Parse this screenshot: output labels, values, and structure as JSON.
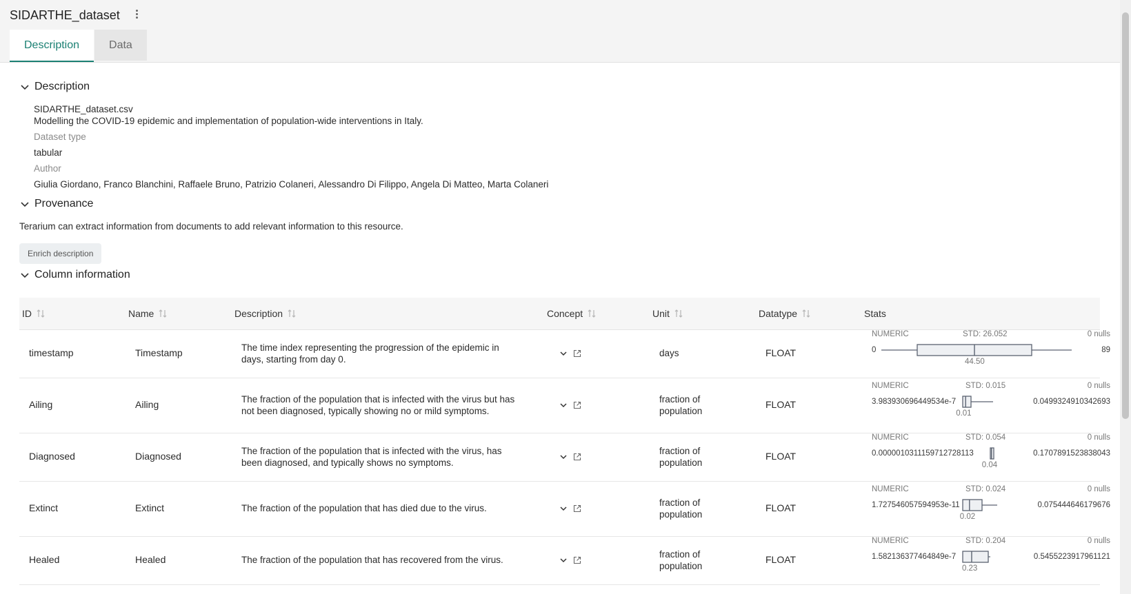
{
  "header": {
    "title": "SIDARTHE_dataset"
  },
  "tabs": [
    {
      "label": "Description"
    },
    {
      "label": "Data"
    }
  ],
  "description": {
    "heading": "Description",
    "filename": "SIDARTHE_dataset.csv",
    "summary": "Modelling the COVID-19 epidemic and implementation of population-wide interventions in Italy.",
    "dataset_type_label": "Dataset type",
    "dataset_type": "tabular",
    "author_label": "Author",
    "author": "Giulia Giordano, Franco Blanchini, Raffaele Bruno, Patrizio Colaneri, Alessandro Di Filippo, Angela Di Matteo, Marta Colaneri"
  },
  "provenance": {
    "heading": "Provenance",
    "text": "Terarium can extract information from documents to add relevant information to this resource.",
    "button": "Enrich description"
  },
  "columns": {
    "heading": "Column information",
    "headers": [
      "ID",
      "Name",
      "Description",
      "Concept",
      "Unit",
      "Datatype",
      "Stats"
    ],
    "rows": [
      {
        "id": "timestamp",
        "name": "Timestamp",
        "desc1": "The time index representing the progression of the epidemic in",
        "desc2": "days, starting from day 0.",
        "unit1": "days",
        "unit2": "",
        "dtype": "FLOAT",
        "s_type": "NUMERIC",
        "s_std": "STD: 26.052",
        "s_nulls": "0 nulls",
        "s_min": "0",
        "s_max": "89",
        "s_median": "44.50",
        "box": {
          "q1": 0.25,
          "med": 0.5,
          "q3": 0.75
        }
      },
      {
        "id": "Ailing",
        "name": "Ailing",
        "desc1": "The fraction of the population that is infected with the virus but has",
        "desc2": "not been diagnosed, typically showing no or mild symptoms.",
        "unit1": "fraction of",
        "unit2": "population",
        "dtype": "FLOAT",
        "s_type": "NUMERIC",
        "s_std": "STD: 0.015",
        "s_nulls": "0 nulls",
        "s_min": "3.983930696449534e-7",
        "s_max": "0.0499324910342693",
        "s_median": "0.01",
        "box": {
          "q1": 0.08,
          "med": 0.2,
          "q3": 0.4
        }
      },
      {
        "id": "Diagnosed",
        "name": "Diagnosed",
        "desc1": "The fraction of the population that is infected with the virus, has",
        "desc2": "been diagnosed, and typically shows no symptoms.",
        "unit1": "fraction of",
        "unit2": "population",
        "dtype": "FLOAT",
        "s_type": "NUMERIC",
        "s_std": "STD: 0.054",
        "s_nulls": "0 nulls",
        "s_min": "0.0000010311159712728113",
        "s_max": "0.1707891523838043",
        "s_median": "0.04",
        "box": {
          "q1": 0.2,
          "med": 0.45,
          "q3": 0.8
        }
      },
      {
        "id": "Extinct",
        "name": "Extinct",
        "desc1": "The fraction of the population that has died due to the virus.",
        "desc2": "",
        "unit1": "fraction of",
        "unit2": "population",
        "dtype": "FLOAT",
        "s_type": "NUMERIC",
        "s_std": "STD: 0.024",
        "s_nulls": "0 nulls",
        "s_min": "1.727546057594953e-11",
        "s_max": "0.075444646179676",
        "s_median": "0.02",
        "box": {
          "q1": 0.05,
          "med": 0.12,
          "q3": 0.55
        }
      },
      {
        "id": "Healed",
        "name": "Healed",
        "desc1": "The fraction of the population that has recovered from the virus.",
        "desc2": "",
        "unit1": "fraction of",
        "unit2": "population",
        "dtype": "FLOAT",
        "s_type": "NUMERIC",
        "s_std": "STD: 0.204",
        "s_nulls": "0 nulls",
        "s_min": "1.582136377464849e-7",
        "s_max": "0.5455223917961121",
        "s_median": "0.23",
        "box": {
          "q1": 0.05,
          "med": 0.3,
          "q3": 0.65
        }
      }
    ]
  },
  "colors": {
    "accent": "#1b8073",
    "box_fill": "#eef0f3",
    "box_stroke": "#5a6270"
  }
}
